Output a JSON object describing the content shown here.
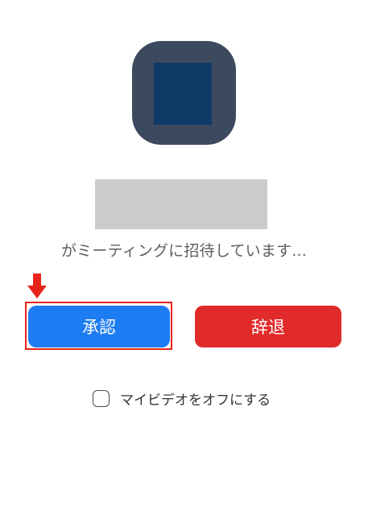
{
  "invite": {
    "message": "がミーティングに招待しています..."
  },
  "actions": {
    "accept_label": "承認",
    "decline_label": "辞退"
  },
  "options": {
    "video_off_label": "マイビデオをオフにする",
    "video_off_checked": false
  },
  "annotation": {
    "highlight_color": "#e8231b"
  },
  "colors": {
    "accept": "#1d7cf2",
    "decline": "#e12b2b",
    "avatar_bg": "#3b4a5f",
    "avatar_inner": "#0e3a66"
  },
  "icons": {
    "annotation_arrow": "down-arrow-icon"
  }
}
